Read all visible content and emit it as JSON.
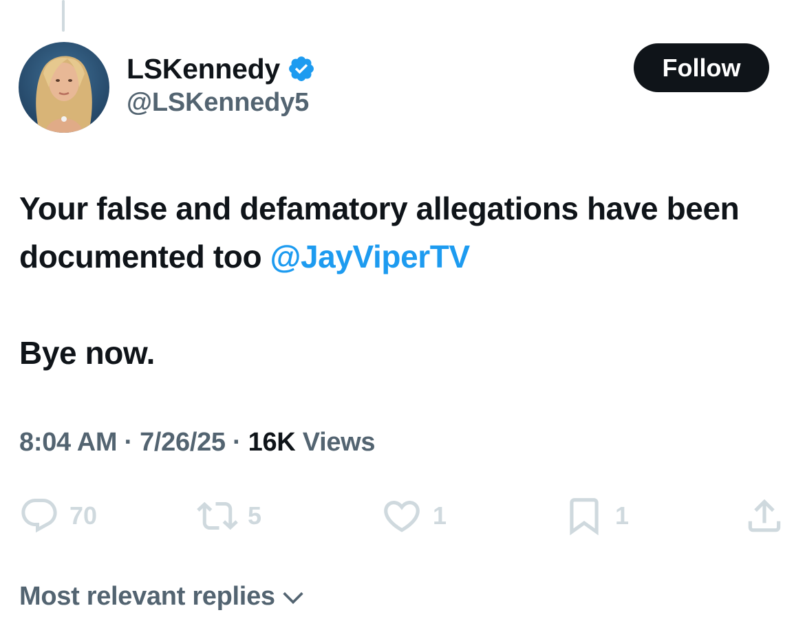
{
  "author": {
    "display_name": "LSKennedy",
    "handle": "@LSKennedy5",
    "verified": true
  },
  "follow_button": {
    "label": "Follow"
  },
  "tweet": {
    "line1_text": "Your false and defamatory allegations have been  documented too ",
    "mention": "@JayViperTV",
    "line2_text": "Bye now."
  },
  "meta": {
    "time": "8:04 AM",
    "separator": " · ",
    "date": "7/26/25",
    "views_count": "16K",
    "views_label": " Views"
  },
  "actions": {
    "replies": {
      "icon": "reply-icon",
      "count": "70"
    },
    "reposts": {
      "icon": "repost-icon",
      "count": "5"
    },
    "likes": {
      "icon": "heart-icon",
      "count": "1"
    },
    "bookmarks": {
      "icon": "bookmark-icon",
      "count": "1"
    },
    "share": {
      "icon": "share-icon"
    }
  },
  "replies_sort": {
    "label": "Most relevant replies",
    "icon": "chevron-down-icon"
  },
  "colors": {
    "accent": "#1d9bf0",
    "text_primary": "#0f1419",
    "text_secondary": "#536471",
    "muted_icon": "#cfd9de",
    "button_bg": "#0f1419"
  }
}
